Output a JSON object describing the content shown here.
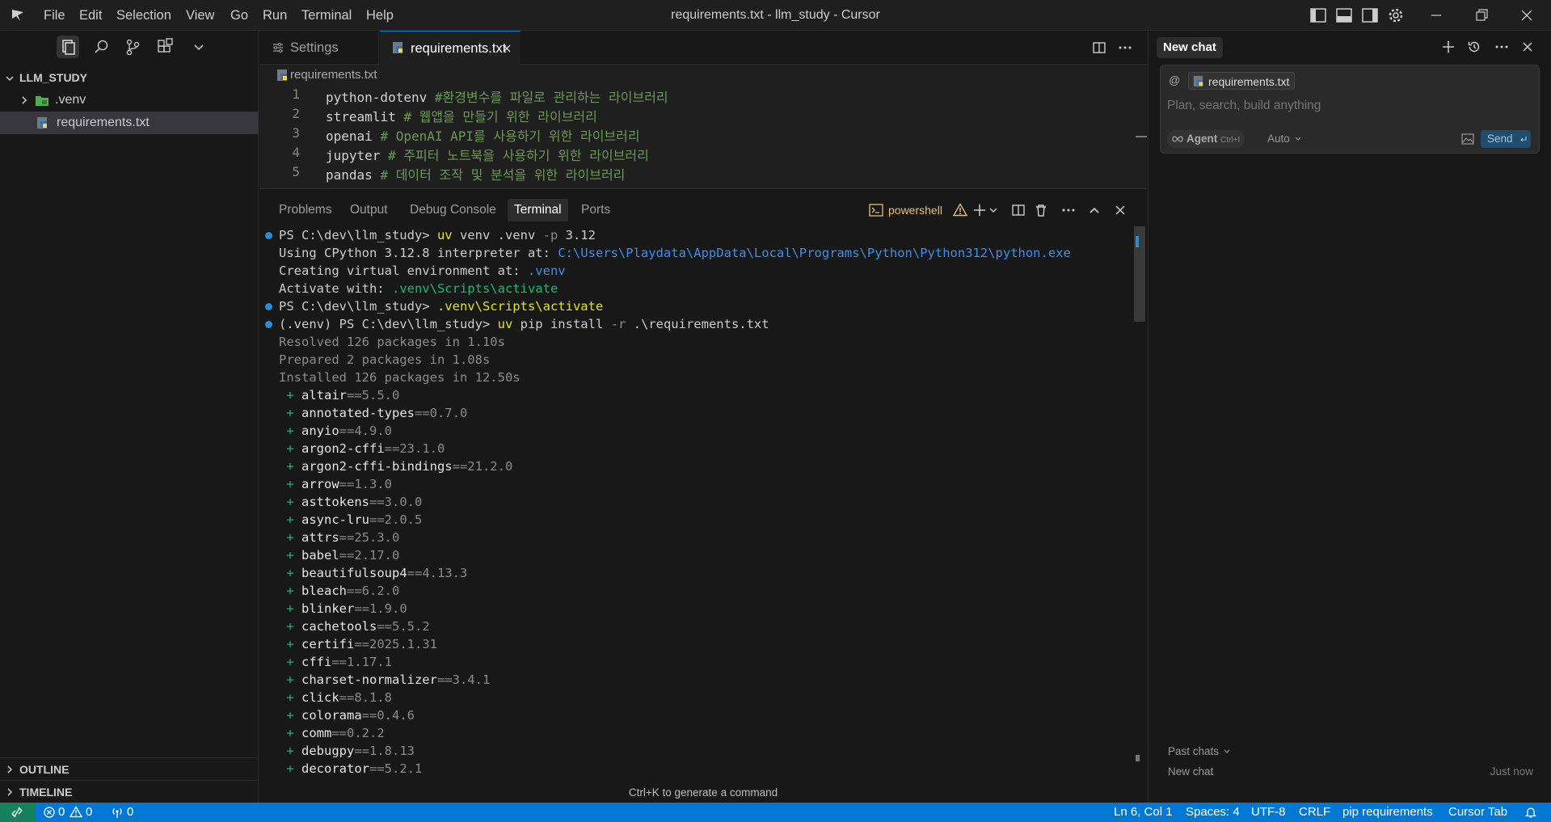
{
  "window": {
    "title": "requirements.txt - llm_study - Cursor"
  },
  "menu": [
    "File",
    "Edit",
    "Selection",
    "View",
    "Go",
    "Run",
    "Terminal",
    "Help"
  ],
  "explorer": {
    "root": "LLM_STUDY",
    "items": [
      ".venv",
      "requirements.txt"
    ],
    "outline": "OUTLINE",
    "timeline": "TIMELINE"
  },
  "tabs": [
    {
      "label": "Settings"
    },
    {
      "label": "requirements.txt"
    }
  ],
  "breadcrumb": "requirements.txt",
  "editor_lines": [
    {
      "num": "1",
      "code": "python-dotenv ",
      "comment": "#환경변수를 파일로 관리하는 라이브러리"
    },
    {
      "num": "2",
      "code": "streamlit ",
      "comment": "# 웹앱을 만들기 위한 라이브러리"
    },
    {
      "num": "3",
      "code": "openai ",
      "comment": "# OpenAI API를 사용하기 위한 라이브러리"
    },
    {
      "num": "4",
      "code": "jupyter ",
      "comment": "# 주피터 노트북을 사용하기 위한 라이브러리"
    },
    {
      "num": "5",
      "code": "pandas ",
      "comment": "# 데이터 조작 및 분석을 위한 라이브러리"
    }
  ],
  "panel": {
    "tabs": [
      "Problems",
      "Output",
      "Debug Console",
      "Terminal",
      "Ports"
    ],
    "shell": "powershell",
    "hint": "Ctrl+K to generate a command"
  },
  "terminal": {
    "l1_prompt": "PS C:\\dev\\llm_study> ",
    "l1_cmd": "uv",
    "l1_rest": " venv .venv ",
    "l1_flag": "-p",
    "l1_ver": " 3.12",
    "l2_text": "Using CPython 3.12.8 interpreter at: ",
    "l2_path": "C:\\Users\\Playdata\\AppData\\Local\\Programs\\Python\\Python312\\python.exe",
    "l3_text": "Creating virtual environment at: ",
    "l3_path": ".venv",
    "l4_text": "Activate with: ",
    "l4_path": ".venv\\Scripts\\activate",
    "l5_prompt": "PS C:\\dev\\llm_study> ",
    "l5_cmd": ".venv\\Scripts\\activate",
    "l6_prompt": "(.venv) PS C:\\dev\\llm_study> ",
    "l6_cmd": "uv",
    "l6_rest": " pip install ",
    "l6_flag": "-r",
    "l6_file": " .\\requirements.txt",
    "resolved": "Resolved 126 packages in 1.10s",
    "prepared": "Prepared 2 packages in 1.08s",
    "installed": "Installed 126 packages in 12.50s",
    "packages": [
      {
        "name": "altair",
        "ver": "==5.5.0"
      },
      {
        "name": "annotated-types",
        "ver": "==0.7.0"
      },
      {
        "name": "anyio",
        "ver": "==4.9.0"
      },
      {
        "name": "argon2-cffi",
        "ver": "==23.1.0"
      },
      {
        "name": "argon2-cffi-bindings",
        "ver": "==21.2.0"
      },
      {
        "name": "arrow",
        "ver": "==1.3.0"
      },
      {
        "name": "asttokens",
        "ver": "==3.0.0"
      },
      {
        "name": "async-lru",
        "ver": "==2.0.5"
      },
      {
        "name": "attrs",
        "ver": "==25.3.0"
      },
      {
        "name": "babel",
        "ver": "==2.17.0"
      },
      {
        "name": "beautifulsoup4",
        "ver": "==4.13.3"
      },
      {
        "name": "bleach",
        "ver": "==6.2.0"
      },
      {
        "name": "blinker",
        "ver": "==1.9.0"
      },
      {
        "name": "cachetools",
        "ver": "==5.5.2"
      },
      {
        "name": "certifi",
        "ver": "==2025.1.31"
      },
      {
        "name": "cffi",
        "ver": "==1.17.1"
      },
      {
        "name": "charset-normalizer",
        "ver": "==3.4.1"
      },
      {
        "name": "click",
        "ver": "==8.1.8"
      },
      {
        "name": "colorama",
        "ver": "==0.4.6"
      },
      {
        "name": "comm",
        "ver": "==0.2.2"
      },
      {
        "name": "debugpy",
        "ver": "==1.8.13"
      },
      {
        "name": "decorator",
        "ver": "==5.2.1"
      }
    ]
  },
  "chat": {
    "title": "New chat",
    "at": "@",
    "context_file": "requirements.txt",
    "placeholder": "Plan, search, build anything",
    "mode": "Agent",
    "mode_shortcut": "Ctrl+I",
    "model": "Auto",
    "send": "Send",
    "past_chats": "Past chats",
    "history_item": "New chat",
    "history_time": "Just now"
  },
  "status": {
    "errors": "0",
    "warnings": "0",
    "ports": "0",
    "position": "Ln 6, Col 1",
    "spaces": "Spaces: 4",
    "encoding": "UTF-8",
    "eol": "CRLF",
    "language": "pip requirements",
    "cursor_tab": "Cursor Tab"
  },
  "colors": {
    "accent": "#0078d4",
    "terminal_yellow": "#e5e510",
    "terminal_blue": "#3b8eea",
    "terminal_green": "#0dbc79",
    "comment": "#6a9955"
  }
}
